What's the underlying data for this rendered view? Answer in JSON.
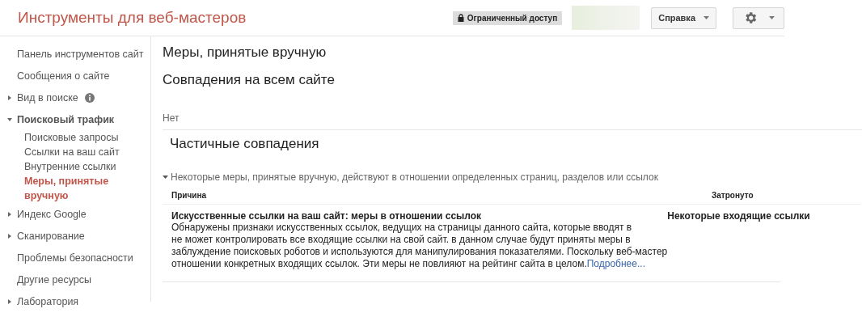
{
  "header": {
    "title": "Инструменты для веб-мастеров",
    "access_badge": "Ограниченный доступ",
    "help_button": "Справка"
  },
  "sidebar": {
    "items": [
      {
        "label": "Панель инструментов сайт",
        "kind": "plain",
        "selected": false
      },
      {
        "label": "Сообщения о сайте",
        "kind": "plain",
        "selected": false
      },
      {
        "label": "Вид в поиске",
        "kind": "group",
        "expanded": false,
        "info": true,
        "selected": false
      },
      {
        "label": "Поисковый трафик",
        "kind": "group",
        "expanded": true,
        "selected": false,
        "children": [
          {
            "label": "Поисковые запросы",
            "selected": false
          },
          {
            "label": "Ссылки на ваш сайт",
            "selected": false
          },
          {
            "label": "Внутренние ссылки",
            "selected": false
          },
          {
            "label": "Меры, принятые вручную",
            "selected": true
          }
        ]
      },
      {
        "label": "Индекс Google",
        "kind": "group",
        "expanded": false,
        "selected": false
      },
      {
        "label": "Сканирование",
        "kind": "group",
        "expanded": false,
        "selected": false
      },
      {
        "label": "Проблемы безопасности",
        "kind": "plain",
        "selected": false
      },
      {
        "label": "Другие ресурсы",
        "kind": "plain",
        "selected": false
      },
      {
        "label": "Лаборатория",
        "kind": "group",
        "expanded": false,
        "selected": false
      }
    ]
  },
  "main": {
    "page_title": "Меры, принятые вручную",
    "site_section": {
      "heading": "Совпадения на всем сайте",
      "value": "Нет"
    },
    "partial_section": {
      "heading": "Частичные совпадения",
      "summary": "Некоторые меры, принятые вручную, действуют в отношении определенных страниц, разделов или ссылок",
      "expanded": true,
      "columns": [
        "Причина",
        "Затронуто"
      ],
      "rows": [
        {
          "title": "Искусственные ссылки на ваш сайт: меры в отношении ссылок",
          "description": [
            "Обнаружены признаки искусственных ссылок, ведущих на страницы данного сайта, которые вводят в",
            "не может контролировать все входящие ссылки на свой сайт. в данном случае будут приняты меры в",
            "заблуждение поисковых роботов и используются для манипулирования показателями. Поскольку веб-мастер",
            "отношении конкретных входящих ссылок. Эти меры не повлияют на рейтинг сайта в целом."
          ],
          "link": "Подробнее...",
          "affected": "Некоторые входящие ссылки"
        }
      ]
    }
  }
}
